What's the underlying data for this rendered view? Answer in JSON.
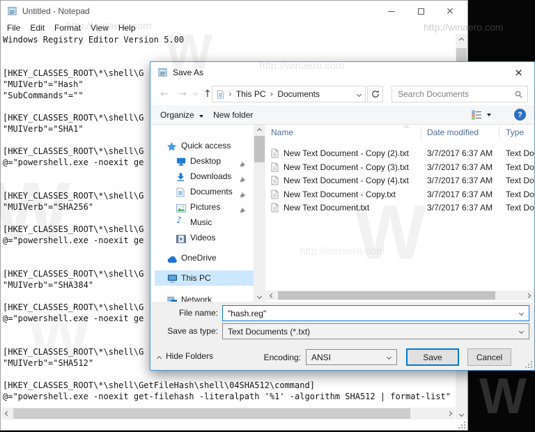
{
  "notepad": {
    "title": "Untitled - Notepad",
    "menu": [
      "File",
      "Edit",
      "Format",
      "View",
      "Help"
    ],
    "editor_lines": [
      "Windows Registry Editor Version 5.00",
      "",
      "",
      "[HKEY_CLASSES_ROOT\\*\\shell\\G",
      "\"MUIVerb\"=\"Hash\"",
      "\"SubCommands\"=\"\"",
      "",
      "[HKEY_CLASSES_ROOT\\*\\shell\\G",
      "\"MUIVerb\"=\"SHA1\"",
      "",
      "[HKEY_CLASSES_ROOT\\*\\shell\\G",
      "@=\"powershell.exe -noexit ge",
      "",
      "",
      "[HKEY_CLASSES_ROOT\\*\\shell\\G",
      "\"MUIVerb\"=\"SHA256\"",
      "",
      "[HKEY_CLASSES_ROOT\\*\\shell\\G",
      "@=\"powershell.exe -noexit ge",
      "",
      "",
      "[HKEY_CLASSES_ROOT\\*\\shell\\G",
      "\"MUIVerb\"=\"SHA384\"",
      "",
      "[HKEY_CLASSES_ROOT\\*\\shell\\G",
      "@=\"powershell.exe -noexit ge",
      "",
      "",
      "[HKEY_CLASSES_ROOT\\*\\shell\\G",
      "\"MUIVerb\"=\"SHA512\"",
      "",
      "[HKEY_CLASSES_ROOT\\*\\shell\\GetFileHash\\shell\\04SHA512\\command]",
      "@=\"powershell.exe -noexit get-filehash -literalpath '%1' -algorithm SHA512 | format-list\""
    ]
  },
  "dialog": {
    "title": "Save As",
    "breadcrumb": [
      "This PC",
      "Documents"
    ],
    "search_placeholder": "Search Documents",
    "toolbar": {
      "organize": "Organize",
      "new_folder": "New folder"
    },
    "columns": [
      "Name",
      "Date modified",
      "Type"
    ],
    "files": [
      {
        "name": "New Text Document - Copy (2).txt",
        "date": "3/7/2017 6:37 AM",
        "type": "Text Docu"
      },
      {
        "name": "New Text Document - Copy (3).txt",
        "date": "3/7/2017 6:37 AM",
        "type": "Text Docu"
      },
      {
        "name": "New Text Document - Copy (4).txt",
        "date": "3/7/2017 6:37 AM",
        "type": "Text Docu"
      },
      {
        "name": "New Text Document - Copy.txt",
        "date": "3/7/2017 6:37 AM",
        "type": "Text Docu"
      },
      {
        "name": "New Text Document.txt",
        "date": "3/7/2017 6:37 AM",
        "type": "Text Docu"
      }
    ],
    "sidebar": [
      {
        "label": "Quick access"
      },
      {
        "label": "Desktop"
      },
      {
        "label": "Downloads"
      },
      {
        "label": "Documents"
      },
      {
        "label": "Pictures"
      },
      {
        "label": "Music"
      },
      {
        "label": "Videos"
      },
      {
        "label": "OneDrive"
      },
      {
        "label": "This PC"
      },
      {
        "label": "Network"
      }
    ],
    "file_name_label": "File name:",
    "file_name_value": "\"hash.reg\"",
    "save_type_label": "Save as type:",
    "save_type_value": "Text Documents (*.txt)",
    "hide_folders_label": "Hide Folders",
    "encoding_label": "Encoding:",
    "encoding_value": "ANSI",
    "save_label": "Save",
    "cancel_label": "Cancel"
  },
  "glyphs": {
    "close": "×",
    "back": "←",
    "forward": "→",
    "up": "↑",
    "crumb_sep": "›",
    "music_note": "♪",
    "question": "?"
  },
  "watermark": {
    "letter": "W",
    "url": "http://winaero.com"
  },
  "colors": {
    "accent": "#0078d7",
    "dialog_border": "#4795d3",
    "selection": "#cce8ff",
    "header_text": "#4a6e96"
  }
}
